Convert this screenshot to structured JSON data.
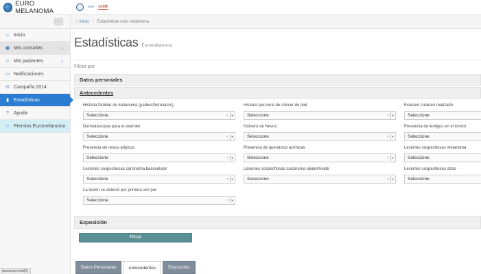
{
  "header": {
    "brand_name": "EURO MELANOMA",
    "partner_logo_2": "aseo",
    "partner_logo_3": "IADE"
  },
  "sidebar": {
    "toggle_icon": "‹ ›",
    "items": [
      {
        "label": "Inicio",
        "icon": "home-icon"
      },
      {
        "label": "Mis consultas",
        "icon": "camera-icon"
      },
      {
        "label": "Mis pacientes",
        "icon": "users-icon"
      },
      {
        "label": "Notificaciones",
        "icon": "monitor-icon"
      },
      {
        "label": "Campaña 2014",
        "icon": "map-marker-icon"
      },
      {
        "label": "Estadísticas",
        "icon": "bar-chart-icon"
      },
      {
        "label": "Ayuda",
        "icon": "question-icon"
      },
      {
        "label": "Premios Euromelanoma",
        "icon": "star-icon"
      }
    ]
  },
  "breadcrumb": {
    "home": "Inicio",
    "current": "Estadísticas euro melanoma"
  },
  "page": {
    "title": "Estadísticas",
    "subtitle": "Euromelanoma",
    "filter_label": "Filtrar por"
  },
  "sections": {
    "datos_personales": "Datos personales",
    "antecedentes": "Antecedentes",
    "exposicion": "Exposición"
  },
  "fields": [
    {
      "label": "Historia familiar de melanoma (padres/hermanos)",
      "value": "Seleccione"
    },
    {
      "label": "Historia personal de cáncer de piel",
      "value": "Seleccione"
    },
    {
      "label": "Examen cutaneo realizado",
      "value": "Seleccione"
    },
    {
      "label": "Dermatoscopia para el examen",
      "value": "Seleccione"
    },
    {
      "label": "Número de Nevus",
      "value": "Seleccione"
    },
    {
      "label": "Presencia de lentigos en el tronco",
      "value": "Seleccione"
    },
    {
      "label": "Presencia de nevus atípicos",
      "value": "Seleccione"
    },
    {
      "label": "Presencia de queratosis actínicas",
      "value": "Seleccione"
    },
    {
      "label": "Lesiones sospechosas melanoma",
      "value": "Seleccione"
    },
    {
      "label": "Lesiones sospechosas carcinoma basocelular",
      "value": "Seleccione"
    },
    {
      "label": "Lesiones sospechosas carcinoma epidermoide",
      "value": "Seleccione"
    },
    {
      "label": "Lesiones sospechosas otros",
      "value": "Seleccione"
    },
    {
      "label": "La lesión se detectó por primera vez por",
      "value": "Seleccione"
    }
  ],
  "actions": {
    "filter_button": "Filtrar"
  },
  "bottom_tabs": [
    {
      "label": "Datos Personales"
    },
    {
      "label": "Antecedentes"
    },
    {
      "label": "Exposición"
    }
  ],
  "status_bar": "javascript:void(0)",
  "colors": {
    "accent_blue": "#2a7dd1",
    "button_teal": "#5a8f96",
    "tab_grey": "#7f8e9a"
  }
}
